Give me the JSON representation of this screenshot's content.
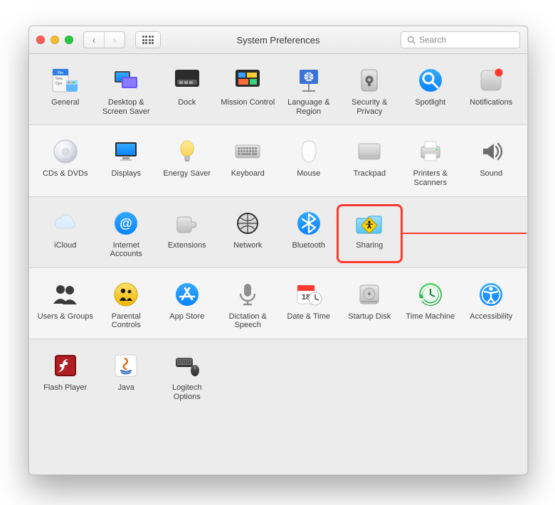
{
  "window": {
    "title": "System Preferences",
    "search_placeholder": "Search"
  },
  "rows": [
    {
      "alt": false,
      "items": [
        {
          "id": "general",
          "label": "General",
          "icon": "general"
        },
        {
          "id": "desktop",
          "label": "Desktop & Screen Saver",
          "icon": "desktop"
        },
        {
          "id": "dock",
          "label": "Dock",
          "icon": "dock"
        },
        {
          "id": "mission",
          "label": "Mission Control",
          "icon": "mission"
        },
        {
          "id": "language",
          "label": "Language & Region",
          "icon": "language"
        },
        {
          "id": "security",
          "label": "Security & Privacy",
          "icon": "security"
        },
        {
          "id": "spotlight",
          "label": "Spotlight",
          "icon": "spotlight"
        },
        {
          "id": "notifications",
          "label": "Notifications",
          "icon": "notifications"
        }
      ]
    },
    {
      "alt": true,
      "items": [
        {
          "id": "cds",
          "label": "CDs & DVDs",
          "icon": "cds"
        },
        {
          "id": "displays",
          "label": "Displays",
          "icon": "displays"
        },
        {
          "id": "energy",
          "label": "Energy Saver",
          "icon": "energy"
        },
        {
          "id": "keyboard",
          "label": "Keyboard",
          "icon": "keyboard"
        },
        {
          "id": "mouse",
          "label": "Mouse",
          "icon": "mouse"
        },
        {
          "id": "trackpad",
          "label": "Trackpad",
          "icon": "trackpad"
        },
        {
          "id": "printers",
          "label": "Printers & Scanners",
          "icon": "printers"
        },
        {
          "id": "sound",
          "label": "Sound",
          "icon": "sound"
        }
      ]
    },
    {
      "alt": false,
      "items": [
        {
          "id": "icloud",
          "label": "iCloud",
          "icon": "icloud"
        },
        {
          "id": "internet",
          "label": "Internet Accounts",
          "icon": "internet"
        },
        {
          "id": "extensions",
          "label": "Extensions",
          "icon": "extensions"
        },
        {
          "id": "network",
          "label": "Network",
          "icon": "network"
        },
        {
          "id": "bluetooth",
          "label": "Bluetooth",
          "icon": "bluetooth"
        },
        {
          "id": "sharing",
          "label": "Sharing",
          "icon": "sharing",
          "highlight": true
        }
      ]
    },
    {
      "alt": true,
      "items": [
        {
          "id": "users",
          "label": "Users & Groups",
          "icon": "users"
        },
        {
          "id": "parental",
          "label": "Parental Controls",
          "icon": "parental"
        },
        {
          "id": "appstore",
          "label": "App Store",
          "icon": "appstore"
        },
        {
          "id": "dictation",
          "label": "Dictation & Speech",
          "icon": "dictation"
        },
        {
          "id": "datetime",
          "label": "Date & Time",
          "icon": "datetime"
        },
        {
          "id": "startup",
          "label": "Startup Disk",
          "icon": "startup"
        },
        {
          "id": "timemachine",
          "label": "Time Machine",
          "icon": "timemachine"
        },
        {
          "id": "accessibility",
          "label": "Accessibility",
          "icon": "accessibility"
        }
      ]
    },
    {
      "alt": false,
      "items": [
        {
          "id": "flash",
          "label": "Flash Player",
          "icon": "flash"
        },
        {
          "id": "java",
          "label": "Java",
          "icon": "java"
        },
        {
          "id": "logitech",
          "label": "Logitech Options",
          "icon": "logitech"
        }
      ]
    }
  ],
  "annotation": {
    "target": "sharing",
    "color": "#ff3b30"
  }
}
